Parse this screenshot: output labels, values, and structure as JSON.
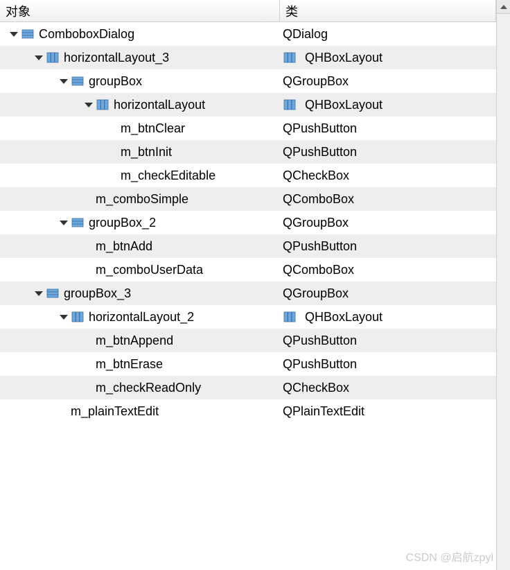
{
  "headers": {
    "object": "对象",
    "class": "类"
  },
  "rows": [
    {
      "indent": 0,
      "expand": true,
      "icon": "dialog",
      "object": "ComboboxDialog",
      "classIcon": null,
      "class": "QDialog",
      "striped": false
    },
    {
      "indent": 1,
      "expand": true,
      "icon": "hbox",
      "object": "horizontalLayout_3",
      "classIcon": "hbox",
      "class": "QHBoxLayout",
      "striped": true
    },
    {
      "indent": 2,
      "expand": true,
      "icon": "dialog",
      "object": "groupBox",
      "classIcon": null,
      "class": "QGroupBox",
      "striped": false
    },
    {
      "indent": 3,
      "expand": true,
      "icon": "hbox",
      "object": "horizontalLayout",
      "classIcon": "hbox",
      "class": "QHBoxLayout",
      "striped": true
    },
    {
      "indent": 4,
      "expand": false,
      "icon": null,
      "object": "m_btnClear",
      "classIcon": null,
      "class": "QPushButton",
      "striped": false
    },
    {
      "indent": 4,
      "expand": false,
      "icon": null,
      "object": "m_btnInit",
      "classIcon": null,
      "class": "QPushButton",
      "striped": true
    },
    {
      "indent": 4,
      "expand": false,
      "icon": null,
      "object": "m_checkEditable",
      "classIcon": null,
      "class": "QCheckBox",
      "striped": false
    },
    {
      "indent": 3,
      "expand": false,
      "icon": null,
      "object": "m_comboSimple",
      "classIcon": null,
      "class": "QComboBox",
      "striped": true
    },
    {
      "indent": 2,
      "expand": true,
      "icon": "dialog",
      "object": "groupBox_2",
      "classIcon": null,
      "class": "QGroupBox",
      "striped": false
    },
    {
      "indent": 3,
      "expand": false,
      "icon": null,
      "object": "m_btnAdd",
      "classIcon": null,
      "class": "QPushButton",
      "striped": true
    },
    {
      "indent": 3,
      "expand": false,
      "icon": null,
      "object": "m_comboUserData",
      "classIcon": null,
      "class": "QComboBox",
      "striped": false
    },
    {
      "indent": 1,
      "expand": true,
      "icon": "dialog",
      "object": "groupBox_3",
      "classIcon": null,
      "class": "QGroupBox",
      "striped": true
    },
    {
      "indent": 2,
      "expand": true,
      "icon": "hbox",
      "object": "horizontalLayout_2",
      "classIcon": "hbox",
      "class": "QHBoxLayout",
      "striped": false
    },
    {
      "indent": 3,
      "expand": false,
      "icon": null,
      "object": "m_btnAppend",
      "classIcon": null,
      "class": "QPushButton",
      "striped": true
    },
    {
      "indent": 3,
      "expand": false,
      "icon": null,
      "object": "m_btnErase",
      "classIcon": null,
      "class": "QPushButton",
      "striped": false
    },
    {
      "indent": 3,
      "expand": false,
      "icon": null,
      "object": "m_checkReadOnly",
      "classIcon": null,
      "class": "QCheckBox",
      "striped": true
    },
    {
      "indent": 2,
      "expand": false,
      "icon": null,
      "object": "m_plainTextEdit",
      "classIcon": null,
      "class": "QPlainTextEdit",
      "striped": false
    }
  ],
  "watermark": "CSDN @启航zpyl"
}
